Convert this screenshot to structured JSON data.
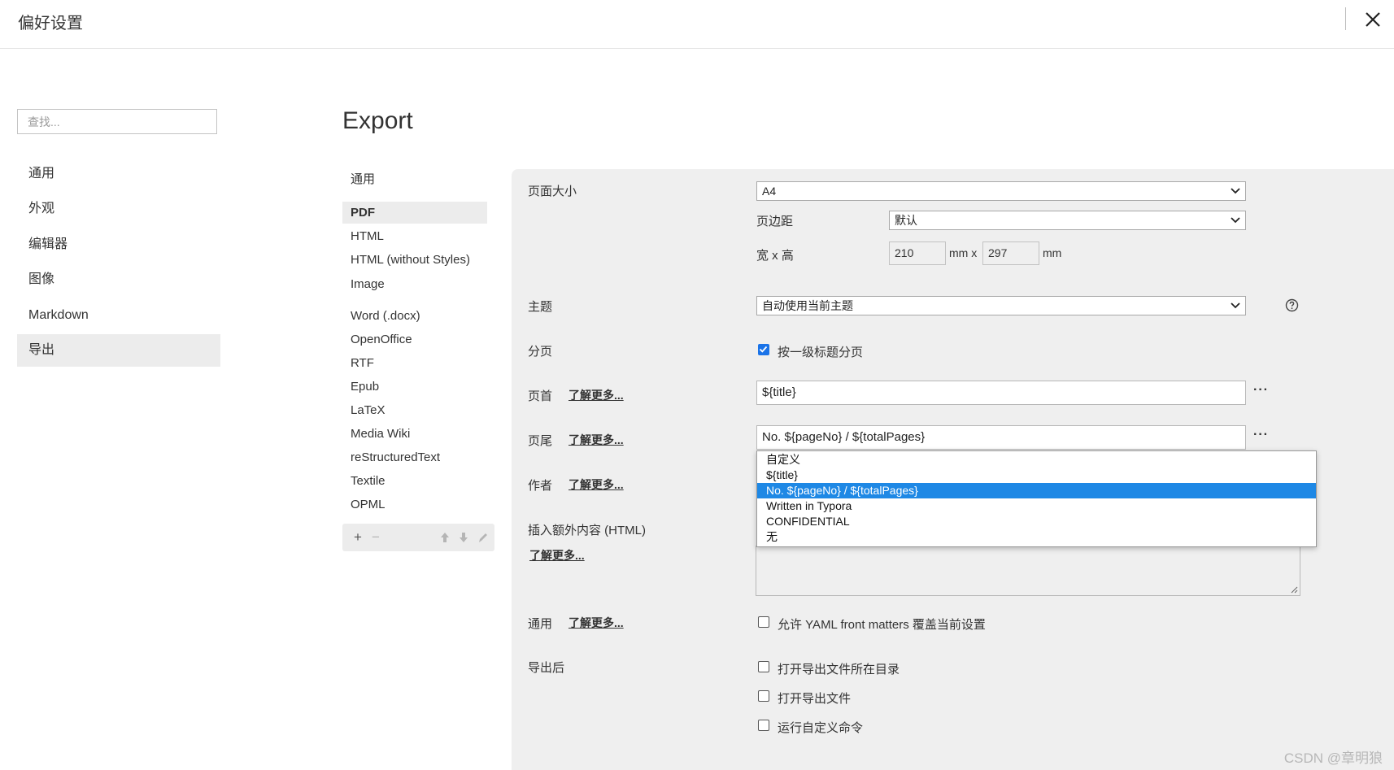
{
  "window": {
    "title": "偏好设置"
  },
  "search": {
    "placeholder": "查找..."
  },
  "nav": {
    "items": [
      {
        "label": "通用"
      },
      {
        "label": "外观"
      },
      {
        "label": "编辑器"
      },
      {
        "label": "图像"
      },
      {
        "label": "Markdown"
      },
      {
        "label": "导出",
        "active": true
      }
    ]
  },
  "export": {
    "heading": "Export",
    "formats": [
      {
        "label": "通用"
      },
      {
        "label": "PDF",
        "active": true
      },
      {
        "label": "HTML"
      },
      {
        "label": "HTML (without Styles)"
      },
      {
        "label": "Image"
      },
      {
        "label": "Word (.docx)"
      },
      {
        "label": "OpenOffice"
      },
      {
        "label": "RTF"
      },
      {
        "label": "Epub"
      },
      {
        "label": "LaTeX"
      },
      {
        "label": "Media Wiki"
      },
      {
        "label": "reStructuredText"
      },
      {
        "label": "Textile"
      },
      {
        "label": "OPML"
      }
    ],
    "toolbar": {
      "add": "+",
      "remove": "−"
    }
  },
  "settings": {
    "learn_more": "了解更多...",
    "page_size": {
      "label": "页面大小",
      "value": "A4"
    },
    "margin": {
      "label": "页边距",
      "value": "默认"
    },
    "dimensions": {
      "label": "宽 x 高",
      "width": "210",
      "unit_x": "mm x",
      "height": "297",
      "unit": "mm"
    },
    "theme": {
      "label": "主题",
      "value": "自动使用当前主题"
    },
    "pagination": {
      "label": "分页",
      "checkbox_label": "按一级标题分页",
      "checked": true
    },
    "header": {
      "label": "页首",
      "value": "${title}",
      "more": "···"
    },
    "footer": {
      "label": "页尾",
      "value": "No. ${pageNo} / ${totalPages}",
      "more": "···"
    },
    "author": {
      "label": "作者"
    },
    "extra_content": {
      "label": "插入额外内容 (HTML)"
    },
    "general": {
      "label": "通用",
      "checkbox_label": "允许 YAML front matters 覆盖当前设置",
      "checked": false
    },
    "after_export": {
      "label": "导出后",
      "options": [
        {
          "label": "打开导出文件所在目录",
          "checked": false
        },
        {
          "label": "打开导出文件",
          "checked": false
        },
        {
          "label": "运行自定义命令",
          "checked": false
        }
      ]
    },
    "footer_dropdown": {
      "options": [
        "自定义",
        "${title}",
        "No. ${pageNo} / ${totalPages}",
        "Written in Typora",
        "CONFIDENTIAL",
        "无"
      ],
      "selected_index": 2
    }
  },
  "watermark": "CSDN @章明狼",
  "colors": {
    "accent": "#1e88e5",
    "panel_bg": "#efefef",
    "active_bg": "#ececec"
  }
}
